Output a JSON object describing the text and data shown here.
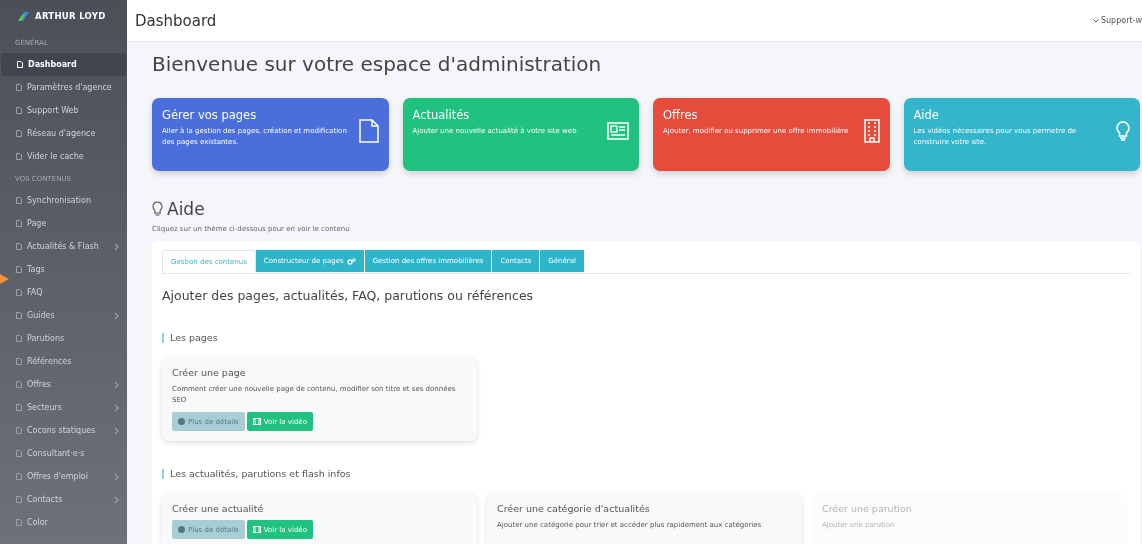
{
  "sidebar": {
    "logo": "ARTHUR LOYD",
    "sections": [
      {
        "title": "GÉNÉRAL",
        "items": [
          {
            "label": "Dashboard",
            "selected": true,
            "submenu": false
          },
          {
            "label": "Paramètres d'agence",
            "selected": false,
            "submenu": false
          },
          {
            "label": "Support Web",
            "selected": false,
            "submenu": false
          },
          {
            "label": "Réseau d'agence",
            "selected": false,
            "submenu": false
          },
          {
            "label": "Vider le cache",
            "selected": false,
            "submenu": false
          }
        ]
      },
      {
        "title": "VOS CONTENUS",
        "items": [
          {
            "label": "Synchronisation",
            "selected": false,
            "submenu": false
          },
          {
            "label": "Page",
            "selected": false,
            "submenu": false
          },
          {
            "label": "Actualités & Flash",
            "selected": false,
            "submenu": true
          },
          {
            "label": "Tags",
            "selected": false,
            "submenu": false
          },
          {
            "label": "FAQ",
            "selected": false,
            "submenu": false
          },
          {
            "label": "Guides",
            "selected": false,
            "submenu": true
          },
          {
            "label": "Parutions",
            "selected": false,
            "submenu": false
          },
          {
            "label": "Références",
            "selected": false,
            "submenu": false
          },
          {
            "label": "Offres",
            "selected": false,
            "submenu": true
          },
          {
            "label": "Secteurs",
            "selected": false,
            "submenu": true
          },
          {
            "label": "Cocons statiques",
            "selected": false,
            "submenu": true
          },
          {
            "label": "Consultant·e·s",
            "selected": false,
            "submenu": false
          },
          {
            "label": "Offres d'emploi",
            "selected": false,
            "submenu": true
          },
          {
            "label": "Contacts",
            "selected": false,
            "submenu": true
          },
          {
            "label": "Color",
            "selected": false,
            "submenu": false
          }
        ]
      }
    ]
  },
  "topbar": {
    "title": "Dashboard",
    "user_menu": "Support-w"
  },
  "welcome": "Bienvenue sur votre espace d'administration",
  "shortcuts": [
    {
      "title": "Gérer vos pages",
      "text": "Aller à la gestion des pages, création et modification des pages existantes.",
      "color": "#4a6fdc"
    },
    {
      "title": "Actualités",
      "text": "Ajouter une nouvelle actualité à votre site web",
      "color": "#21c17f"
    },
    {
      "title": "Offres",
      "text": "Ajouter, modifier ou supprimer une offre immobilière",
      "color": "#e54c3c"
    },
    {
      "title": "Aide",
      "text": "Les vidéos nécessaires pour vous permetre de construire votre site.",
      "color": "#33b5cb"
    }
  ],
  "help": {
    "title": "Aide",
    "subtitle": "Cliquez sur un thème ci-dessous pour en voir le contenu",
    "tabs": [
      {
        "label": "Gestion des contenus",
        "selected": true
      },
      {
        "label": "Constructeur de pages",
        "selected": false
      },
      {
        "label": "Gestion des offres immobilières",
        "selected": false
      },
      {
        "label": "Contacts",
        "selected": false
      },
      {
        "label": "Général",
        "selected": false
      }
    ],
    "heading": "Ajouter des pages, actualités, FAQ, parutions ou références",
    "sections": [
      {
        "title": "Les pages",
        "cards": [
          {
            "title": "Créer une page",
            "text": "Comment créer une nouvelle page de contenu, modifier son titre et ses données SEO",
            "disabled": false,
            "buttons": [
              {
                "label": "Plus de détails",
                "kind": "details",
                "disabled": true
              },
              {
                "label": "Voir la vidéo",
                "kind": "video",
                "disabled": false
              }
            ]
          }
        ]
      },
      {
        "title": "Les actualités, parutions et flash infos",
        "cards": [
          {
            "title": "Créer une actualité",
            "disabled": false,
            "buttons": [
              {
                "label": "Plus de détails",
                "kind": "details",
                "disabled": true
              },
              {
                "label": "Voir la vidéo",
                "kind": "video",
                "disabled": false
              }
            ]
          },
          {
            "title": "Créer une catégorie d'actualités",
            "text": "Ajouter une catégorie pour trier et accéder plus rapidement aux catégories",
            "disabled": false
          },
          {
            "title": "Créer une parution",
            "text": "Ajouter une parution",
            "disabled": true
          }
        ]
      }
    ]
  }
}
